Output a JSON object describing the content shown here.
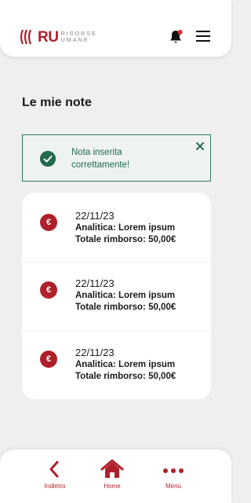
{
  "header": {
    "logo_ru": "RU",
    "logo_word_1": "RISORSE",
    "logo_word_2": "UMANE",
    "icons": [
      "notification-bell-icon",
      "hamburger-menu-icon"
    ]
  },
  "page": {
    "title": "Le mie note"
  },
  "alert": {
    "message": "Nota inserita correttamente!"
  },
  "notes": [
    {
      "date": "22/11/23",
      "analytics": "Analitica: Lorem ipsum",
      "refund": "Totale rimborso: 50,00€",
      "badge": "€"
    },
    {
      "date": "22/11/23",
      "analytics": "Analitica: Lorem ipsum",
      "refund": "Totale rimborso: 50,00€",
      "badge": "€"
    },
    {
      "date": "22/11/23",
      "analytics": "Analitica: Lorem ipsum",
      "refund": "Totale rimborso: 50,00€",
      "badge": "€"
    }
  ],
  "bottom_nav": [
    {
      "label": "Indietro",
      "icon": "chevron-left-icon"
    },
    {
      "label": "Home",
      "icon": "home-icon"
    },
    {
      "label": "Menù",
      "icon": "more-dots-icon"
    }
  ],
  "colors": {
    "brand_red": "#b0202a",
    "success_green": "#226b4f",
    "background": "#efefef"
  }
}
